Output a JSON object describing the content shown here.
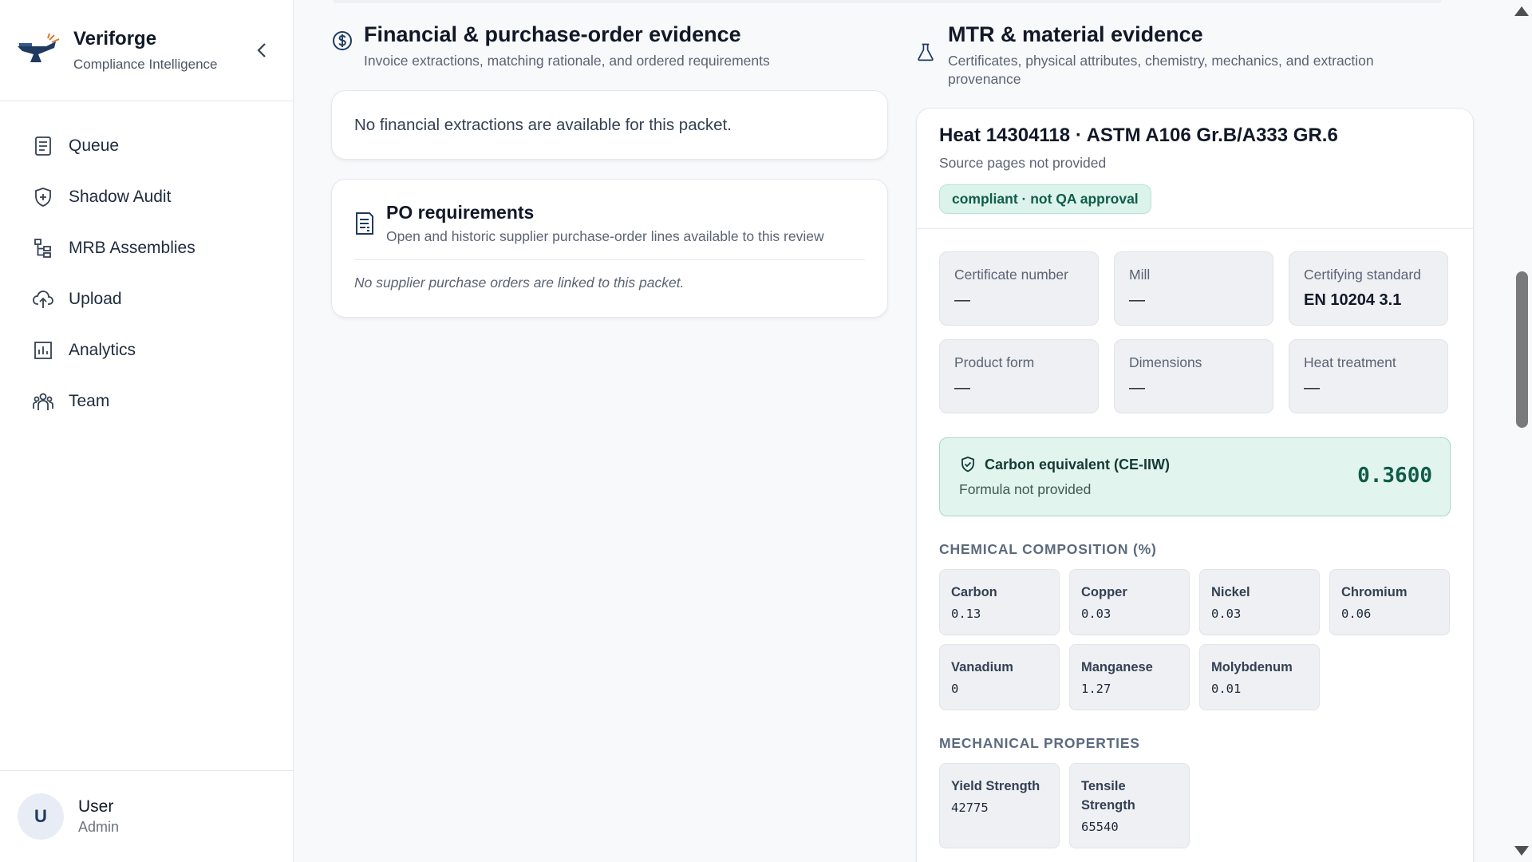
{
  "brand": {
    "name": "Veriforge",
    "subtitle": "Compliance Intelligence"
  },
  "nav": {
    "items": [
      {
        "label": "Queue",
        "icon": "document-list-icon"
      },
      {
        "label": "Shadow Audit",
        "icon": "shield-plus-icon"
      },
      {
        "label": "MRB Assemblies",
        "icon": "hierarchy-icon"
      },
      {
        "label": "Upload",
        "icon": "cloud-upload-icon"
      },
      {
        "label": "Analytics",
        "icon": "bar-chart-icon"
      },
      {
        "label": "Team",
        "icon": "team-icon"
      }
    ]
  },
  "user": {
    "initial": "U",
    "name": "User",
    "role": "Admin"
  },
  "financial": {
    "title": "Financial & purchase-order evidence",
    "subtitle": "Invoice extractions, matching rationale, and ordered requirements",
    "empty_text": "No financial extractions are available for this packet.",
    "po": {
      "title": "PO requirements",
      "subtitle": "Open and historic supplier purchase-order lines available to this review",
      "empty_text": "No supplier purchase orders are linked to this packet."
    }
  },
  "mtr": {
    "title": "MTR & material evidence",
    "subtitle_line1": "Certificates, physical attributes, chemistry, mechanics, and extraction",
    "subtitle_line2": "provenance",
    "heat_title": "Heat 14304118 · ASTM A106 Gr.B/A333 GR.6",
    "source_pages": "Source pages not provided",
    "status_pill": "compliant · not QA approval",
    "attributes": [
      {
        "label": "Certificate number",
        "value": "—"
      },
      {
        "label": "Mill",
        "value": "—"
      },
      {
        "label": "Certifying standard",
        "value": "EN 10204 3.1"
      },
      {
        "label": "Product form",
        "value": "—"
      },
      {
        "label": "Dimensions",
        "value": "—"
      },
      {
        "label": "Heat treatment",
        "value": "—"
      }
    ],
    "carbon_equivalent": {
      "label": "Carbon equivalent (CE-IIW)",
      "formula": "Formula not provided",
      "value": "0.3600"
    },
    "chemical_title": "CHEMICAL COMPOSITION (%)",
    "chemicals": [
      {
        "label": "Carbon",
        "value": "0.13"
      },
      {
        "label": "Copper",
        "value": "0.03"
      },
      {
        "label": "Nickel",
        "value": "0.03"
      },
      {
        "label": "Chromium",
        "value": "0.06"
      },
      {
        "label": "Vanadium",
        "value": "0"
      },
      {
        "label": "Manganese",
        "value": "1.27"
      },
      {
        "label": "Molybdenum",
        "value": "0.01"
      }
    ],
    "mechanical_title": "MECHANICAL PROPERTIES",
    "mechanical": [
      {
        "label": "Yield Strength",
        "value": "42775"
      },
      {
        "label": "Tensile Strength",
        "value": "65540"
      }
    ]
  },
  "colors": {
    "accent": "#1e3a5f",
    "success_bg": "#e1f4ee",
    "success_text": "#0f5d48"
  }
}
